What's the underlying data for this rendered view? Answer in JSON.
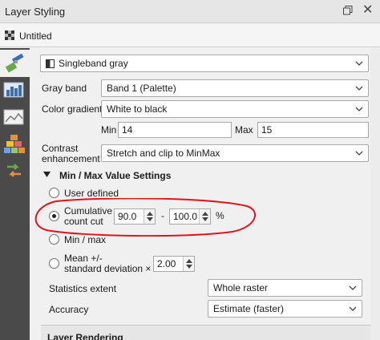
{
  "panel": {
    "title": "Layer Styling",
    "close_glyph": "✕",
    "layer_name": "Untitled"
  },
  "sidebar": {
    "icons": [
      "paintbrush-icon",
      "symbology-icon",
      "transparency-icon",
      "pyramids-icon",
      "history-icon"
    ]
  },
  "renderer": {
    "type": "Singleband gray"
  },
  "fields": {
    "gray_band_label": "Gray band",
    "gray_band_value": "Band 1 (Palette)",
    "color_gradient_label": "Color gradient",
    "color_gradient_value": "White to black",
    "min_label": "Min",
    "min_value": "14",
    "max_label": "Max",
    "max_value": "15",
    "contrast_label_line1": "Contrast",
    "contrast_label_line2": "enhancement",
    "contrast_value": "Stretch and clip to MinMax"
  },
  "minmax": {
    "section_title": "Min / Max Value Settings",
    "user_defined": "User defined",
    "cumulative_line1": "Cumulative",
    "cumulative_line2": "count cut",
    "cumulative_from": "90.0",
    "cumulative_dash": "-",
    "cumulative_to": "100.0",
    "percent": "%",
    "min_max": "Min / max",
    "mean_line1": "Mean +/-",
    "mean_line2": "standard deviation ×",
    "stddev_value": "2.00",
    "selected": "cumulative",
    "statistics_extent_label": "Statistics extent",
    "statistics_extent_value": "Whole raster",
    "accuracy_label": "Accuracy",
    "accuracy_value": "Estimate (faster)"
  },
  "layer_rendering": {
    "title": "Layer Rendering"
  },
  "colors": {
    "annotation": "#e0141e",
    "sidebar": "#4a4a4a"
  }
}
